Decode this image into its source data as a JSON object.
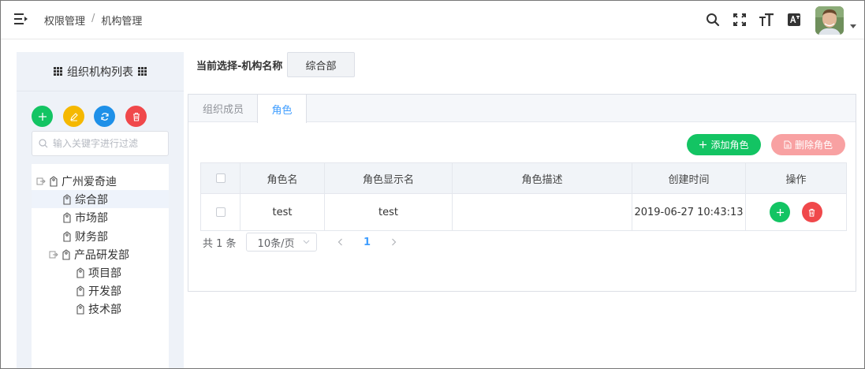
{
  "header": {
    "breadcrumb": [
      "权限管理",
      "机构管理"
    ],
    "breadcrumb_separator": "/",
    "icons": [
      "menu-fold-icon",
      "search-icon",
      "fullscreen-icon",
      "font-size-icon",
      "translate-icon"
    ]
  },
  "sidebar": {
    "title": "组织机构列表",
    "filter_placeholder": "输入关键字进行过滤",
    "tree": [
      {
        "label": "广州爱奇迪",
        "level": 0,
        "expanded": true,
        "selected": false
      },
      {
        "label": "综合部",
        "level": 1,
        "selected": true
      },
      {
        "label": "市场部",
        "level": 1,
        "selected": false
      },
      {
        "label": "财务部",
        "level": 1,
        "selected": false
      },
      {
        "label": "产品研发部",
        "level": 1,
        "expanded": true,
        "selected": false
      },
      {
        "label": "项目部",
        "level": 2,
        "selected": false
      },
      {
        "label": "开发部",
        "level": 2,
        "selected": false
      },
      {
        "label": "技术部",
        "level": 2,
        "selected": false
      }
    ]
  },
  "main": {
    "selection_label": "当前选择-机构名称",
    "selection_value": "综合部",
    "tabs": [
      {
        "label": "组织成员",
        "active": false
      },
      {
        "label": "角色",
        "active": true
      }
    ],
    "add_role_label": "添加角色",
    "delete_role_label": "删除角色",
    "table": {
      "columns": [
        "角色名",
        "角色显示名",
        "角色描述",
        "创建时间",
        "操作"
      ],
      "rows": [
        {
          "name": "test",
          "display_name": "test",
          "description": "",
          "created": "2019-06-27 10:43:13"
        }
      ]
    },
    "pager": {
      "total": "共 1 条",
      "page_size": "10条/页",
      "current_page": "1"
    }
  },
  "colors": {
    "green": "#13c463",
    "yellow": "#f5b800",
    "blue": "#1e90e8",
    "red": "#f0484b",
    "red_light": "#f8a1a2",
    "primary": "#409eff"
  }
}
